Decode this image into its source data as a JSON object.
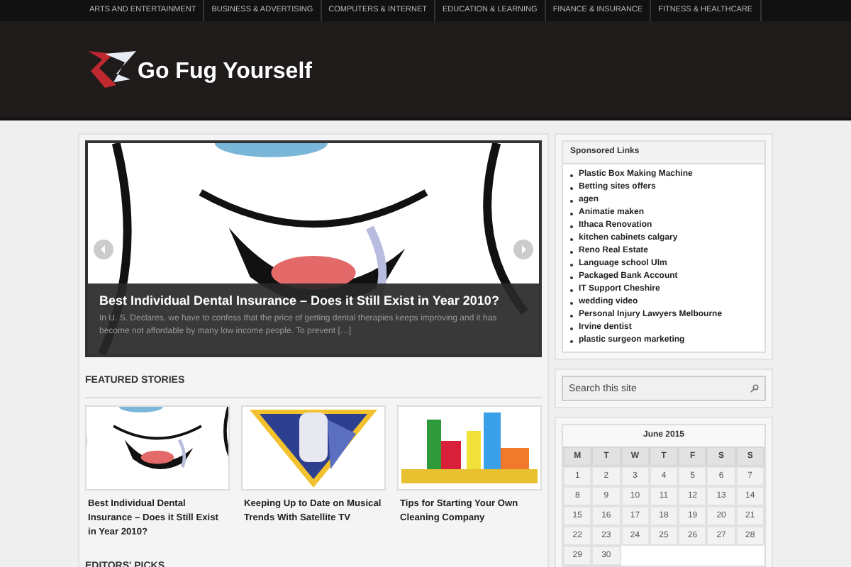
{
  "nav": [
    "ARTS AND ENTERTAINMENT",
    "BUSINESS & ADVERTISING",
    "COMPUTERS & INTERNET",
    "EDUCATION & LEARNING",
    "FINANCE & INSURANCE",
    "FITNESS & HEALTHCARE"
  ],
  "site_title": "Go Fug Yourself",
  "slider": {
    "title": "Best Individual Dental Insurance – Does it Still Exist in Year 2010?",
    "excerpt": "In U. S. Declares, we have to confess that the price of getting dental therapies keeps improving and it has become not affordable by many low income people. To prevent […]"
  },
  "featured": {
    "heading": "FEATURED STORIES",
    "stories": [
      {
        "title": "Best Individual Dental Insurance – Does it Still Exist in Year 2010?"
      },
      {
        "title": "Keeping Up to Date on Musical Trends With Satellite TV"
      },
      {
        "title": "Tips for Starting Your Own Cleaning Company"
      }
    ]
  },
  "editors_heading": "EDITORS' PICKS",
  "sponsored": {
    "heading": "Sponsored Links",
    "links": [
      "Plastic Box Making Machine",
      "Betting sites offers",
      "agen",
      "Animatie maken",
      "Ithaca Renovation",
      "kitchen cabinets calgary",
      "Reno Real Estate",
      "Language school Ulm",
      "Packaged Bank Account",
      "IT Support Cheshire",
      "wedding video",
      "Personal Injury Lawyers Melbourne",
      "Irvine dentist",
      "plastic surgeon marketing"
    ]
  },
  "search": {
    "placeholder": "Search this site"
  },
  "calendar": {
    "title": "June 2015",
    "weekdays": [
      "M",
      "T",
      "W",
      "T",
      "F",
      "S",
      "S"
    ],
    "weeks": [
      [
        "1",
        "2",
        "3",
        "4",
        "5",
        "6",
        "7"
      ],
      [
        "8",
        "9",
        "10",
        "11",
        "12",
        "13",
        "14"
      ],
      [
        "15",
        "16",
        "17",
        "18",
        "19",
        "20",
        "21"
      ],
      [
        "22",
        "23",
        "24",
        "25",
        "26",
        "27",
        "28"
      ],
      [
        "29",
        "30"
      ]
    ]
  }
}
